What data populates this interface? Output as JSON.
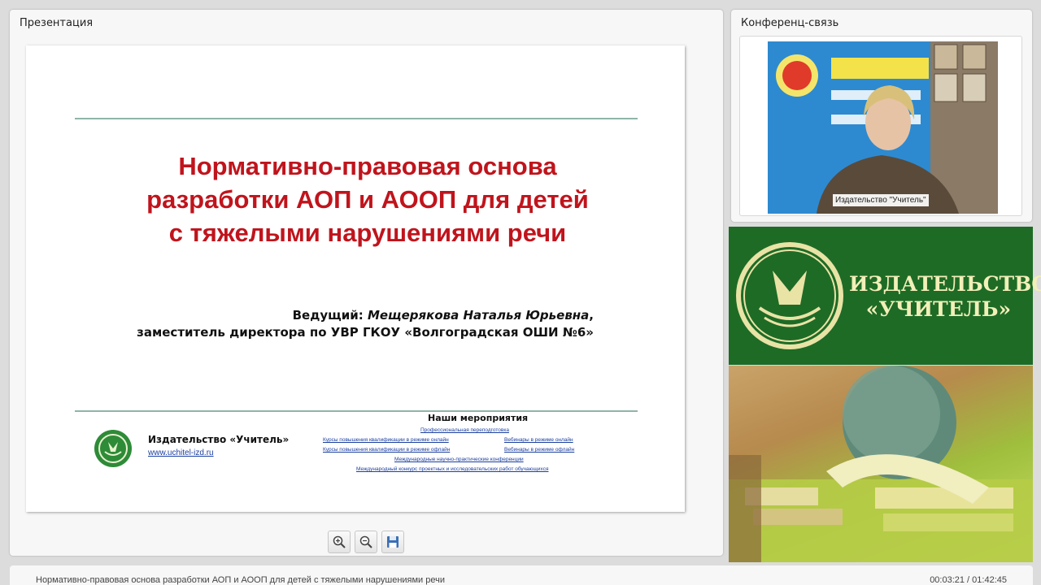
{
  "presentation_panel": {
    "title": "Презентация",
    "slide": {
      "title_lines": [
        "Нормативно-правовая основа",
        "разработки АОП и АООП для детей",
        "с тяжелыми нарушениями речи"
      ],
      "presenter_prefix": "Ведущий: ",
      "presenter_name": "Мещерякова Наталья Юрьевна",
      "presenter_suffix": ",",
      "presenter_role": "заместитель директора по УВР ГКОУ «Волгоградская ОШИ №6»",
      "publisher_name": "Издательство «Учитель»",
      "publisher_url": "www.uchitel-izd.ru",
      "events_title": "Наши мероприятия",
      "events": [
        "Профессиональная переподготовка",
        "Курсы повышения квалификации в режиме онлайн",
        "Вебинары в режиме онлайн",
        "Курсы повышения квалификации в режиме офлайн",
        "Вебинары в режиме офлайн",
        "Международные научно-практические конференции",
        "Международный конкурс проектных и исследовательских работ обучающихся"
      ]
    }
  },
  "conference_panel": {
    "title": "Конференц-связь",
    "video_label": "Издательство \"Учитель\""
  },
  "banner": {
    "line1": "ИЗДАТЕЛЬСТВО",
    "line2": "«УЧИТЕЛЬ»"
  },
  "status_bar": {
    "title": "Нормативно-правовая основа разработки АОП и АООП для детей с тяжелыми нарушениями речи",
    "time": "00:03:21 / 01:42:45"
  },
  "colors": {
    "title_red": "#c0141c",
    "brand_green": "#1e6b26",
    "banner_text": "#f2efb8",
    "link_blue": "#1a3fa0"
  },
  "icons": [
    "zoom-in-icon",
    "zoom-out-icon",
    "save-icon",
    "publisher-logo-icon"
  ]
}
